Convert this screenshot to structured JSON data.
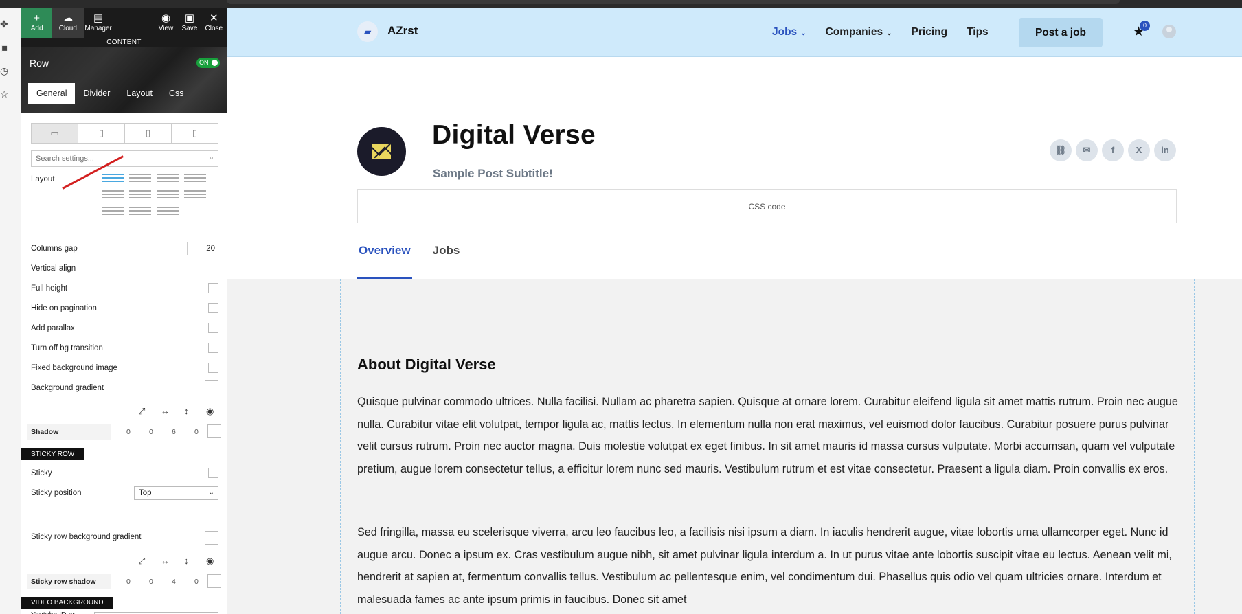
{
  "panel": {
    "toolbar": {
      "add": "Add",
      "cloud": "Cloud",
      "manager": "Manager",
      "view": "View",
      "save": "Save",
      "close": "Close"
    },
    "section": "CONTENT",
    "element_title": "Row",
    "toggle": "ON",
    "tabs": [
      "General",
      "Divider",
      "Layout",
      "Css"
    ],
    "search_placeholder": "Search settings...",
    "settings": {
      "layout": "Layout",
      "columns_gap": "Columns gap",
      "columns_gap_value": "20",
      "vertical_align": "Vertical align",
      "full_height": "Full height",
      "hide_on_pagination": "Hide on pagination",
      "add_parallax": "Add parallax",
      "turn_off_bg_transition": "Turn off bg transition",
      "fixed_background_image": "Fixed background image",
      "background_gradient": "Background gradient",
      "shadow": "Shadow",
      "shadow_values": [
        "0",
        "0",
        "6",
        "0"
      ],
      "sticky_row_heading": "STICKY ROW",
      "sticky": "Sticky",
      "sticky_position": "Sticky position",
      "sticky_position_value": "Top",
      "sticky_row_background_gradient": "Sticky row background gradient",
      "sticky_row_shadow": "Sticky row shadow",
      "sticky_row_shadow_values": [
        "0",
        "0",
        "4",
        "0"
      ],
      "video_background_heading": "VIDEO BACKGROUND",
      "youtube_id": "Youtube ID or"
    }
  },
  "site": {
    "brand": "AZrst",
    "nav": [
      "Jobs",
      "Companies",
      "Pricing",
      "Tips"
    ],
    "post_job": "Post a job",
    "bookmark_count": "0",
    "company": {
      "name": "Digital Verse",
      "subtitle": "Sample Post Subtitle!",
      "css_code": "CSS code"
    },
    "tabs": [
      "Overview",
      "Jobs"
    ],
    "about_heading": "About Digital Verse",
    "paragraph1": "Quisque pulvinar commodo ultrices. Nulla facilisi. Nullam ac pharetra sapien. Quisque at ornare lorem. Curabitur eleifend ligula sit amet mattis rutrum. Proin nec augue nulla. Curabitur vitae elit volutpat, tempor ligula ac, mattis lectus. In elementum nulla non erat maximus, vel euismod dolor faucibus. Curabitur posuere purus pulvinar velit cursus rutrum. Proin nec auctor magna. Duis molestie volutpat ex eget finibus. In sit amet mauris id massa cursus vulputate. Morbi accumsan, quam vel vulputate pretium, augue lorem consectetur tellus, a efficitur lorem nunc sed mauris. Vestibulum rutrum et est vitae consectetur. Praesent a ligula diam. Proin convallis ex eros.",
    "paragraph2": "Sed fringilla, massa eu scelerisque viverra, arcu leo faucibus leo, a facilisis nisi ipsum a diam. In iaculis hendrerit augue, vitae lobortis urna ullamcorper eget. Nunc id augue arcu. Donec a ipsum ex. Cras vestibulum augue nibh, sit amet pulvinar ligula interdum a. In ut purus vitae ante lobortis suscipit vitae eu lectus. Aenean velit mi, hendrerit at sapien at, fermentum convallis tellus. Vestibulum ac pellentesque enim, vel condimentum dui. Phasellus quis odio vel quam ultricies ornare. Interdum et malesuada fames ac ante ipsum primis in faucibus. Donec sit amet"
  },
  "colors": {
    "accent": "#2a52be",
    "header_bg": "#cfeafb",
    "content_bg": "#f2f2f2",
    "add_green": "#2e8b57"
  }
}
